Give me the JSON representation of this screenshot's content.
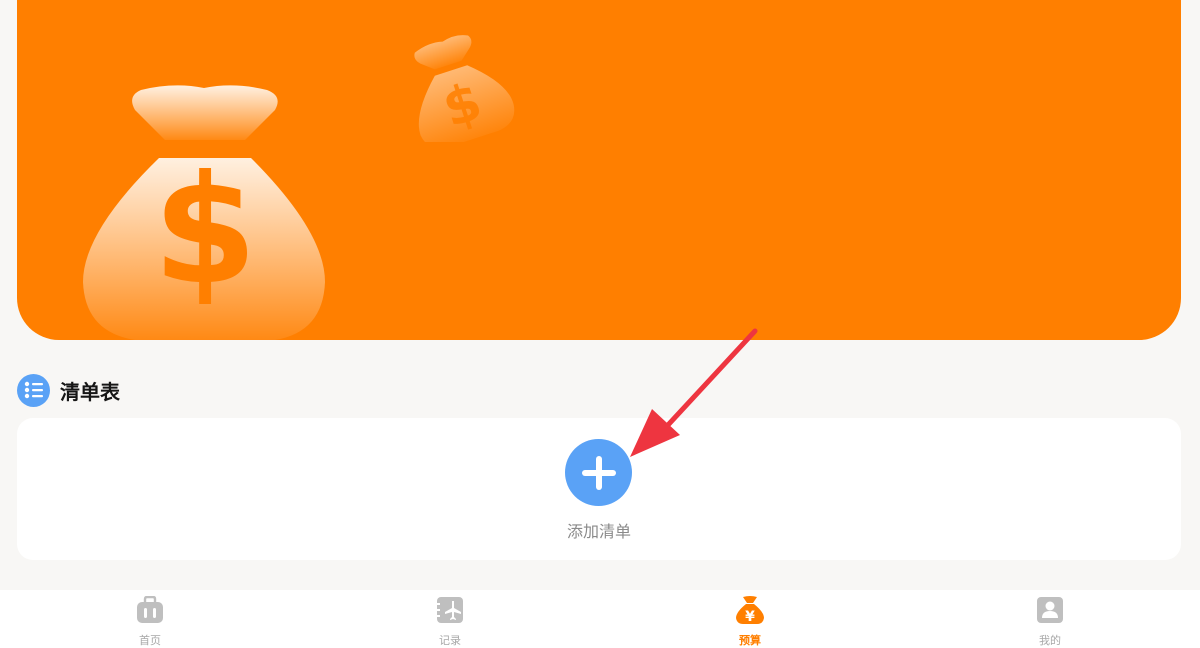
{
  "colors": {
    "accent": "#ff7f00",
    "primary_blue": "#5aa2f6",
    "background": "#f8f7f5",
    "inactive": "#bfbfbf",
    "arrow": "#ee3540"
  },
  "banner": {
    "decorations": [
      "money-bag-icon",
      "money-bag-icon"
    ]
  },
  "checklist": {
    "title": "清单表",
    "icon": "list-icon",
    "add_label": "添加清单",
    "add_icon": "plus-icon"
  },
  "tabbar": {
    "active_index": 2,
    "tabs": [
      {
        "label": "首页",
        "icon": "suitcase-icon"
      },
      {
        "label": "记录",
        "icon": "notebook-plane-icon"
      },
      {
        "label": "预算",
        "icon": "money-bag-yen-icon"
      },
      {
        "label": "我的",
        "icon": "user-profile-icon"
      }
    ]
  }
}
